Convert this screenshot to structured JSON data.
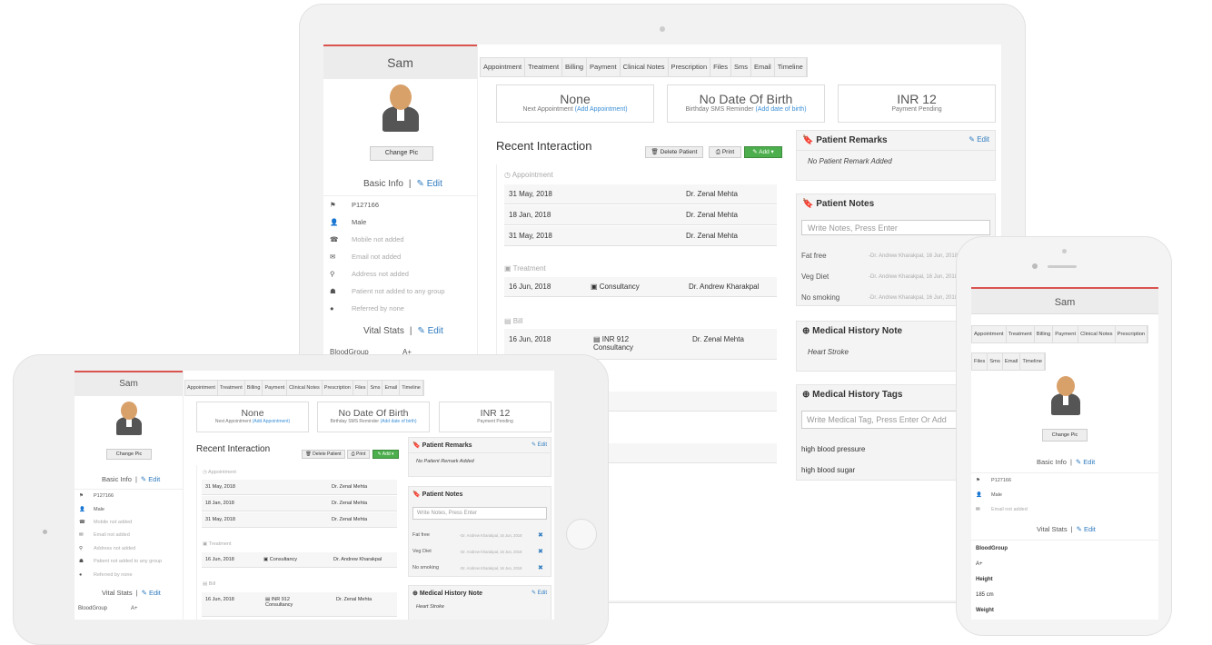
{
  "patient": {
    "name": "Sam",
    "change_pic": "Change Pic",
    "basic_info": "Basic Info",
    "vital_stats": "Vital Stats",
    "edit": "Edit",
    "id": "P127166",
    "gender": "Male",
    "mobile": "Mobile not added",
    "email": "Email not added",
    "address": "Address not added",
    "group": "Patient not added to any group",
    "referred": "Referred by none",
    "blood_group_label": "BloodGroup",
    "blood_group": "A+",
    "height_label": "Height",
    "height": "185 cm",
    "weight_label": "Weight"
  },
  "tabs": [
    "Appointment",
    "Treatment",
    "Billing",
    "Payment",
    "Clinical Notes",
    "Prescription",
    "Files",
    "Sms",
    "Email",
    "Timeline"
  ],
  "summary": {
    "appt_title": "None",
    "appt_sub": "Next Appointment",
    "appt_link": "(Add Appointment)",
    "dob_title": "No Date Of Birth",
    "dob_sub": "Birthday SMS Reminder",
    "dob_link": "(Add date of birth)",
    "pay_title": "INR 12",
    "pay_sub": "Payment Pending"
  },
  "recent": {
    "title": "Recent Interaction",
    "delete": "Delete Patient",
    "print": "Print",
    "add": "Add",
    "appointment_label": "Appointment",
    "treatment_label": "Treatment",
    "bill_label": "Bill",
    "appointments": [
      {
        "date": "31 May, 2018",
        "doctor": "Dr. Zenal Mehta"
      },
      {
        "date": "18 Jan, 2018",
        "doctor": "Dr. Zenal Mehta"
      },
      {
        "date": "31 May, 2018",
        "doctor": "Dr. Zenal Mehta"
      }
    ],
    "treatment": {
      "date": "16 Jun, 2018",
      "item": "Consultancy",
      "doctor": "Dr. Andrew Kharakpal"
    },
    "bill": {
      "date": "16 Jun, 2018",
      "amount": "INR 912",
      "item": "Consultancy",
      "doctor": "Dr. Zenal Mehta"
    }
  },
  "remarks": {
    "title": "Patient Remarks",
    "edit": "Edit",
    "empty": "No Patient Remark Added"
  },
  "notes": {
    "title": "Patient Notes",
    "placeholder": "Write Notes, Press Enter",
    "items": [
      {
        "text": "Fat free",
        "meta": "-Dr. Andrew Kharakpal, 16 Jun, 2018"
      },
      {
        "text": "Veg Diet",
        "meta": "-Dr. Andrew Kharakpal, 16 Jun, 2018"
      },
      {
        "text": "No smoking",
        "meta": "-Dr. Andrew Kharakpal, 16 Jun, 2018"
      }
    ]
  },
  "history_note": {
    "title": "Medical History Note",
    "edit": "Edit",
    "value": "Heart Stroke"
  },
  "history_tags": {
    "title": "Medical History Tags",
    "placeholder": "Write Medical Tag, Press Enter Or Add",
    "items": [
      "high blood pressure",
      "high blood sugar"
    ]
  },
  "colors": {
    "accent_red": "#d9534f",
    "link_blue": "#2f7bbf",
    "add_green": "#4cae4c"
  }
}
